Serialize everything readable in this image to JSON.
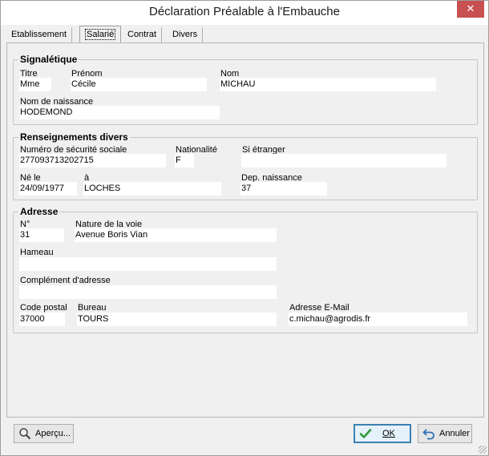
{
  "window": {
    "title": "Déclaration Préalable à l'Embauche",
    "close_glyph": "✕"
  },
  "tabs": [
    {
      "label": "Etablissement"
    },
    {
      "label": "Salarié"
    },
    {
      "label": "Contrat"
    },
    {
      "label": "Divers"
    }
  ],
  "signaletique": {
    "title": "Signalétique",
    "titre_label": "Titre",
    "titre_value": "Mme",
    "prenom_label": "Prénom",
    "prenom_value": "Cécile",
    "nom_label": "Nom",
    "nom_value": "MICHAU",
    "nom_naissance_label": "Nom de naissance",
    "nom_naissance_value": "HODEMOND"
  },
  "renseignements": {
    "title": "Renseignements divers",
    "secu_label": "Numéro de sécurité sociale",
    "secu_value": "277093713202715",
    "nationalite_label": "Nationalité",
    "nationalite_value": "F",
    "etranger_label": "Si étranger",
    "etranger_value": "",
    "ne_le_label": "Né le",
    "ne_le_value": "24/09/1977",
    "a_label": "à",
    "a_value": "LOCHES",
    "dep_label": "Dep. naissance",
    "dep_value": "37"
  },
  "adresse": {
    "title": "Adresse",
    "num_label": "N°",
    "num_value": "31",
    "voie_label": "Nature de la voie",
    "voie_value": "Avenue Boris Vian",
    "hameau_label": "Hameau",
    "hameau_value": "",
    "complement_label": "Complément d'adresse",
    "complement_value": "",
    "cp_label": "Code postal",
    "cp_value": "37000",
    "bureau_label": "Bureau",
    "bureau_value": "TOURS",
    "email_label": "Adresse E-Mail",
    "email_value": "c.michau@agrodis.fr"
  },
  "buttons": {
    "apercu": "Aperçu...",
    "ok": "OK",
    "annuler": "Annuler"
  }
}
